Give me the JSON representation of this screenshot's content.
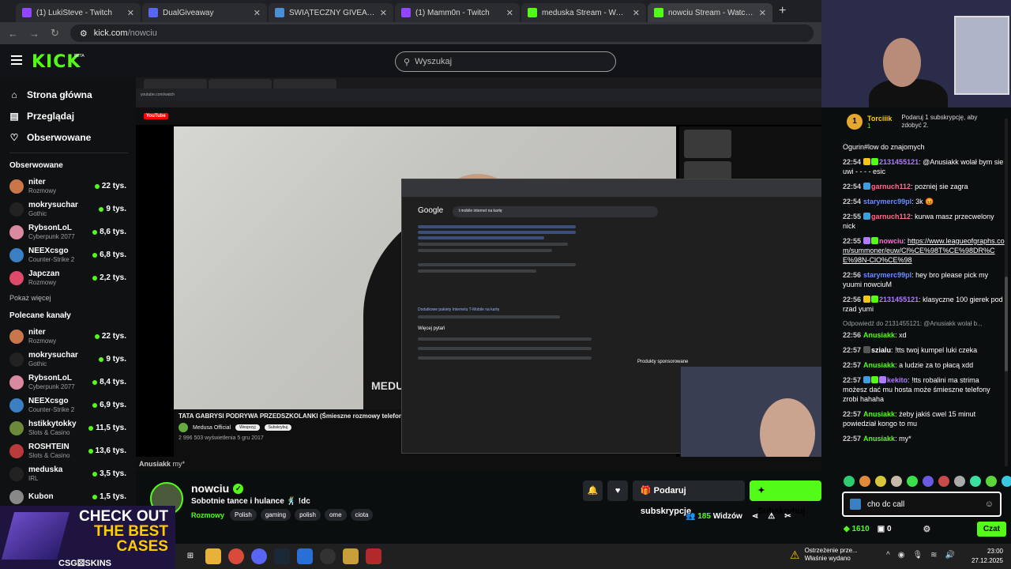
{
  "browser": {
    "tabs": [
      {
        "label": "(1) LukiSteve - Twitch",
        "icon_color": "#9146ff"
      },
      {
        "label": "DualGiveaway",
        "icon_color": "#5865f2"
      },
      {
        "label": "ŚWIĄTECZNY GIVEAWAY",
        "icon_color": "#4a8fd6"
      },
      {
        "label": "(1) Mamm0n - Twitch",
        "icon_color": "#9146ff"
      },
      {
        "label": "meduska Stream - Watch Live o",
        "icon_color": "#53fc18"
      },
      {
        "label": "nowciu Stream - Watch Live on",
        "icon_color": "#53fc18"
      }
    ],
    "url_host": "kick.com",
    "url_path": "/nowciu",
    "new_tab": "+"
  },
  "header": {
    "logo": "KICK",
    "beta": "BETA",
    "search_placeholder": "Wyszukaj"
  },
  "sidebar": {
    "nav": [
      {
        "label": "Strona główna",
        "icon": "home-icon",
        "glyph": "⌂"
      },
      {
        "label": "Przeglądaj",
        "icon": "browse-icon",
        "glyph": "▤"
      },
      {
        "label": "Obserwowane",
        "icon": "heart-icon",
        "glyph": "♡"
      }
    ],
    "followed_title": "Obserwowane",
    "followed": [
      {
        "name": "niter",
        "category": "Rozmowy",
        "viewers": "22 tys.",
        "color": "#c9774a"
      },
      {
        "name": "mokrysuchar",
        "category": "Gothic",
        "viewers": "9 tys.",
        "color": "#222"
      },
      {
        "name": "RybsonLoL",
        "category": "Cyberpunk 2077",
        "viewers": "8,6 tys.",
        "color": "#d98aa0"
      },
      {
        "name": "NEEXcsgo",
        "category": "Counter-Strike 2",
        "viewers": "6,8 tys.",
        "color": "#3a7fc2"
      },
      {
        "name": "Japczan",
        "category": "Rozmowy",
        "viewers": "2,2 tys.",
        "color": "#e04a6a"
      }
    ],
    "show_more": "Pokaż więcej",
    "recommended_title": "Polecane kanały",
    "recommended": [
      {
        "name": "niter",
        "category": "Rozmowy",
        "viewers": "22 tys.",
        "color": "#c9774a"
      },
      {
        "name": "mokrysuchar",
        "category": "Gothic",
        "viewers": "9 tys.",
        "color": "#222"
      },
      {
        "name": "RybsonLoL",
        "category": "Cyberpunk 2077",
        "viewers": "8,4 tys.",
        "color": "#d98aa0"
      },
      {
        "name": "NEEXcsgo",
        "category": "Counter-Strike 2",
        "viewers": "6,9 tys.",
        "color": "#3a7fc2"
      },
      {
        "name": "hstikkytokky",
        "category": "Slots & Casino",
        "viewers": "11,5 tys.",
        "color": "#6a8a3a"
      },
      {
        "name": "ROSHTEIN",
        "category": "Slots & Casino",
        "viewers": "13,6 tys.",
        "color": "#b83a3a"
      },
      {
        "name": "meduska",
        "category": "IRL",
        "viewers": "3,5 tys.",
        "color": "#222"
      },
      {
        "name": "Kubon",
        "category": "",
        "viewers": "1,5 tys.",
        "color": "#888"
      }
    ]
  },
  "video": {
    "yt_logo": "YouTube",
    "yt_title": "TATA GABRYSI PODRYWA PRZEDSZKOLANKI (Śmieszne rozmowy telefoniczne)",
    "yt_channel": "Medusa Official",
    "yt_support": "Wesprzyj",
    "yt_subscribe": "Subskrybuj",
    "yt_views": "2 996 503 wyświetlenia  5 gru 2017",
    "yt_watermark": "MEDUSA",
    "google_logo": "Google",
    "google_query": "t mobile internet na kartę",
    "google_result_link": "Dodatkowe pakiety Internetu T-Mobile na kartę",
    "google_faq": "Więcej pytań",
    "sponsored": "Produkty sponsorowane",
    "inner_overlay_user": "Anusiakk",
    "inner_overlay_msg": "my*"
  },
  "stream": {
    "channel": "nowciu",
    "title": "Sobotnie tance i hulance 🕺 !dc",
    "category": "Rozmowy",
    "tags": [
      "Polish",
      "gaming",
      "polish",
      "ome",
      "ciota"
    ],
    "gift_label": "Podaruj subskrypcje",
    "subscribe_label": "Subskrybuj",
    "viewers": "185",
    "viewers_label": "Widzów"
  },
  "ad": {
    "line1": "CHECK OUT",
    "line2": "THE BEST",
    "line3": "CASES",
    "footer": "CSG⚄SKINS"
  },
  "chat": {
    "pinned_rank": "1",
    "pinned_user": "Torciiik",
    "pinned_count": "1",
    "pinned_text": "Podaruj 1 subskrypcję, aby zdobyć 2.",
    "messages": [
      {
        "time": "",
        "user": "",
        "color": "#fff",
        "text": "Ogurin#low do znajomych",
        "badges": []
      },
      {
        "time": "22:54",
        "user": "2131455121",
        "color": "#b07bff",
        "text": "@Anusiakk wolał bym sie uwi - - - - esic",
        "badges": [
          "#f5c518",
          "#53fc18"
        ]
      },
      {
        "time": "22:54",
        "user": "garnuch112",
        "color": "#ff6b8a",
        "text": "pozniej sie zagra",
        "badges": [
          "#3aa0e0"
        ]
      },
      {
        "time": "22:54",
        "user": "starymerc99pl",
        "color": "#6a8cff",
        "text": "3k 😡",
        "badges": []
      },
      {
        "time": "22:55",
        "user": "garnuch112",
        "color": "#ff6b8a",
        "text": "kurwa masz przecwelony nick",
        "badges": [
          "#3aa0e0"
        ]
      },
      {
        "time": "22:55",
        "user": "nowciu",
        "color": "#ff6bd6",
        "text": "https://www.leagueofgraphs.com/summoner/euw/Cl%CE%98T%CE%98DR%CE%98N-ClO%CE%98",
        "badges": [
          "#b07bff",
          "#53fc18"
        ],
        "link": true
      },
      {
        "time": "22:56",
        "user": "starymerc99pl",
        "color": "#6a8cff",
        "text": "hey bro please pick my yuumi nowciuM",
        "badges": []
      },
      {
        "time": "22:56",
        "user": "2131455121",
        "color": "#b07bff",
        "text": "klasyczne 100 gierek pod rzad yumi",
        "badges": [
          "#f5c518",
          "#53fc18"
        ]
      },
      {
        "time": "22:56",
        "user": "Anusiakk",
        "color": "#53fc18",
        "text": "xd",
        "badges": [],
        "reply": "Odpowiedź do 2131455121: @Anusiakk wolał b..."
      },
      {
        "time": "22:57",
        "user": "szialu",
        "color": "#fff",
        "text": "!tts twoj kumpel luki czeka",
        "badges": [
          "#555"
        ]
      },
      {
        "time": "22:57",
        "user": "Anusiakk",
        "color": "#53fc18",
        "text": "a ludzie za to płacą xdd",
        "badges": []
      },
      {
        "time": "22:57",
        "user": "kekito",
        "color": "#b07bff",
        "text": "!tts robalini ma strima możesz dać mu hosta może śmieszne telefony zrobi hahaha",
        "badges": [
          "#3aa0e0",
          "#53fc18",
          "#b07bff"
        ]
      },
      {
        "time": "22:57",
        "user": "Anusiakk",
        "color": "#53fc18",
        "text": "żeby jakiś cwel 15 minut powiedział kongo to mu",
        "badges": []
      },
      {
        "time": "22:57",
        "user": "Anusiakk",
        "color": "#53fc18",
        "text": "my*",
        "badges": []
      }
    ],
    "input_value": "cho dc call",
    "points": "1610",
    "count": "0",
    "send_label": "Czat"
  },
  "taskbar": {
    "notif_title": "Ostrzeżenie prze...",
    "notif_sub": "Właśnie wydano",
    "time": "23:00",
    "date": "27.12.2025"
  }
}
